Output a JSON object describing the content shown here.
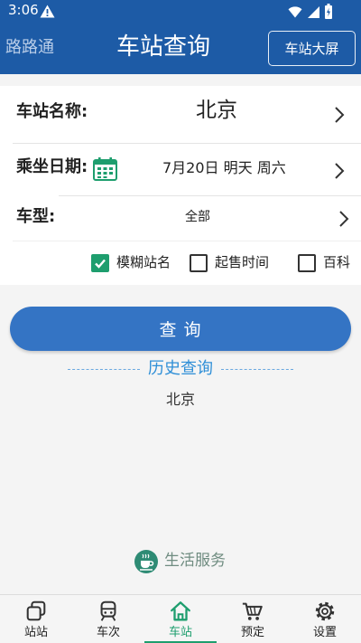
{
  "status_bar": {
    "time": "3:06",
    "icons": [
      "warning-icon",
      "wifi-icon",
      "signal-icon",
      "battery-icon"
    ]
  },
  "header": {
    "app_name": "路路通",
    "title": "车站查询",
    "big_screen_label": "车站大屏"
  },
  "form": {
    "station_label": "车站名称:",
    "station_value": "北京",
    "date_label": "乘坐日期:",
    "date_icon": "calendar-icon",
    "date_value": "7月20日 明天 周六",
    "type_label": "车型:",
    "type_value": "全部",
    "filters": [
      {
        "label": "模糊站名",
        "checked": true
      },
      {
        "label": "起售时间",
        "checked": false
      },
      {
        "label": "百科",
        "checked": false
      }
    ]
  },
  "query_button_label": "查 询",
  "history": {
    "title": "历史查询",
    "items": [
      "北京"
    ]
  },
  "life_service": {
    "label": "生活服务",
    "icon": "coffee-cup-icon"
  },
  "bottom_nav": {
    "items": [
      {
        "label": "站站",
        "icon": "stacked-squares-icon",
        "active": false
      },
      {
        "label": "车次",
        "icon": "train-icon",
        "active": false
      },
      {
        "label": "车站",
        "icon": "house-icon",
        "active": true
      },
      {
        "label": "预定",
        "icon": "cart-icon",
        "active": false
      },
      {
        "label": "设置",
        "icon": "gear-icon",
        "active": false
      }
    ]
  },
  "colors": {
    "primary": "#1d5ba6",
    "button": "#3474c4",
    "accent_green": "#1e9e6e",
    "history_blue": "#2f8fd7"
  }
}
